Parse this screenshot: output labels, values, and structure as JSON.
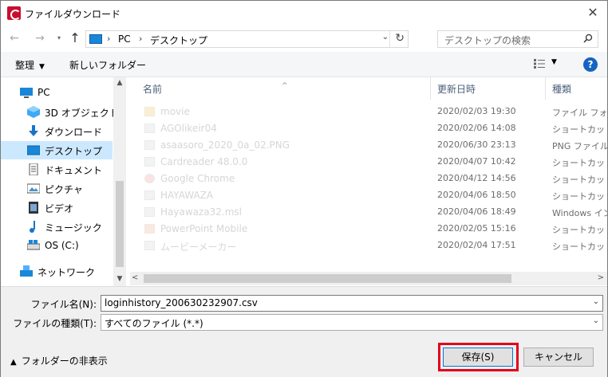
{
  "window": {
    "title": "ファイルダウンロード"
  },
  "address": {
    "crumbs": [
      "PC",
      "デスクトップ"
    ],
    "search_placeholder": "デスクトップの検索"
  },
  "toolbar": {
    "organize": "整理",
    "new_folder": "新しいフォルダー"
  },
  "nav": {
    "items": [
      {
        "label": "PC",
        "icon": "pc-icon"
      },
      {
        "label": "3D オブジェクト",
        "icon": "3d-objects-icon"
      },
      {
        "label": "ダウンロード",
        "icon": "download-icon"
      },
      {
        "label": "デスクトップ",
        "icon": "desktop-icon",
        "selected": true
      },
      {
        "label": "ドキュメント",
        "icon": "documents-icon"
      },
      {
        "label": "ピクチャ",
        "icon": "pictures-icon"
      },
      {
        "label": "ビデオ",
        "icon": "videos-icon"
      },
      {
        "label": "ミュージック",
        "icon": "music-icon"
      },
      {
        "label": "OS (C:)",
        "icon": "drive-icon"
      },
      {
        "label": "ネットワーク",
        "icon": "network-icon"
      }
    ]
  },
  "files": {
    "columns": {
      "name": "名前",
      "modified": "更新日時",
      "type": "種類"
    },
    "rows": [
      {
        "name": "movie",
        "modified": "2020/02/03 19:30",
        "type": "ファイル フォルダー"
      },
      {
        "name": "AGOlikeir04",
        "modified": "2020/02/06 14:08",
        "type": "ショートカット"
      },
      {
        "name": "asaasoro_2020_0a_02.PNG",
        "modified": "2020/06/30 23:13",
        "type": "PNG ファイル"
      },
      {
        "name": "Cardreader 48.0.0",
        "modified": "2020/04/07 10:42",
        "type": "ショートカット"
      },
      {
        "name": "Google Chrome",
        "modified": "2020/04/12 14:56",
        "type": "ショートカット"
      },
      {
        "name": "HAYAWAZA",
        "modified": "2020/04/06 18:50",
        "type": "ショートカット"
      },
      {
        "name": "Hayawaza32.msl",
        "modified": "2020/04/06 18:49",
        "type": "Windows インストーラー"
      },
      {
        "name": "PowerPoint Mobile",
        "modified": "2020/02/05 15:16",
        "type": "ショートカット"
      },
      {
        "name": "ムービーメーカー",
        "modified": "2020/02/04 17:51",
        "type": "ショートカット"
      }
    ]
  },
  "form": {
    "filename_label": "ファイル名(N):",
    "filename_value": "loginhistory_200630232907.csv",
    "filetype_label": "ファイルの種類(T):",
    "filetype_value": "すべてのファイル (*.*)"
  },
  "footer": {
    "hide_folders": "フォルダーの非表示",
    "save": "保存(S)",
    "cancel": "キャンセル"
  }
}
